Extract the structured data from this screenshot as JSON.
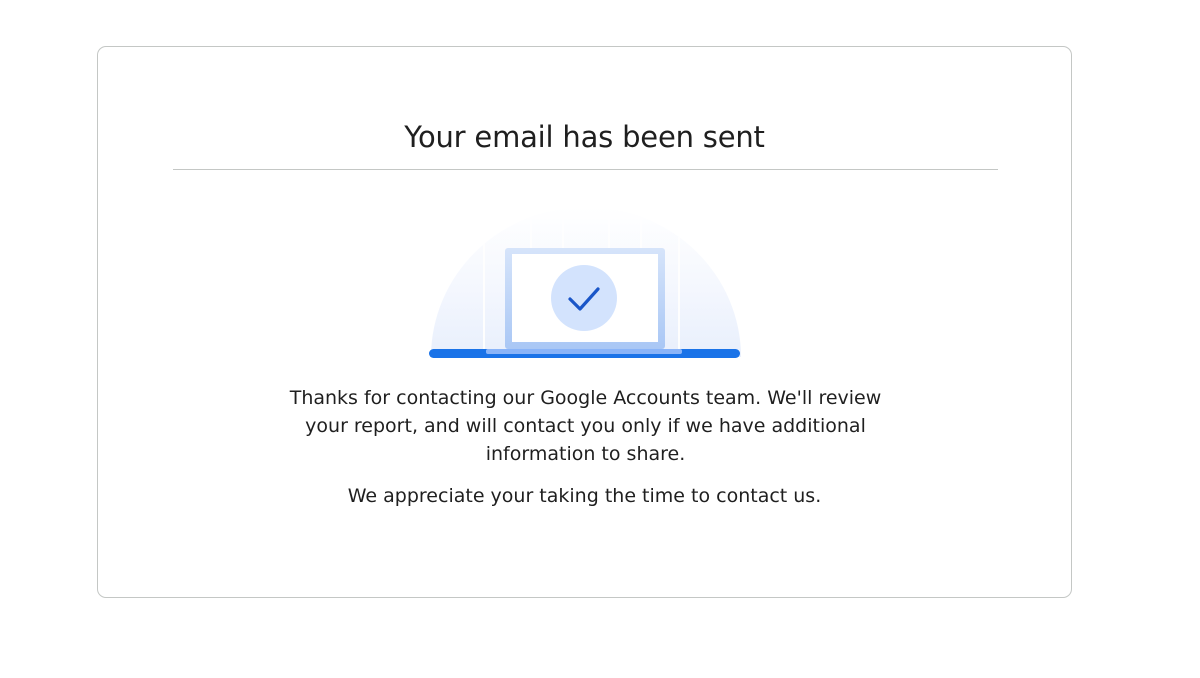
{
  "confirmation": {
    "title": "Your email has been sent",
    "message": "Thanks for contacting our Google Accounts team. We'll review your report, and will contact you only if we have additional information to share.",
    "appreciation": "We appreciate your taking the time to contact us."
  },
  "illustration": {
    "icon": "checkmark-icon",
    "colors": {
      "accent": "#1a73e8",
      "check": "#1a56c8",
      "circle": "#d3e3fd",
      "laptop_frame": "#c2d7f8",
      "glow": "#eef3fd"
    }
  }
}
